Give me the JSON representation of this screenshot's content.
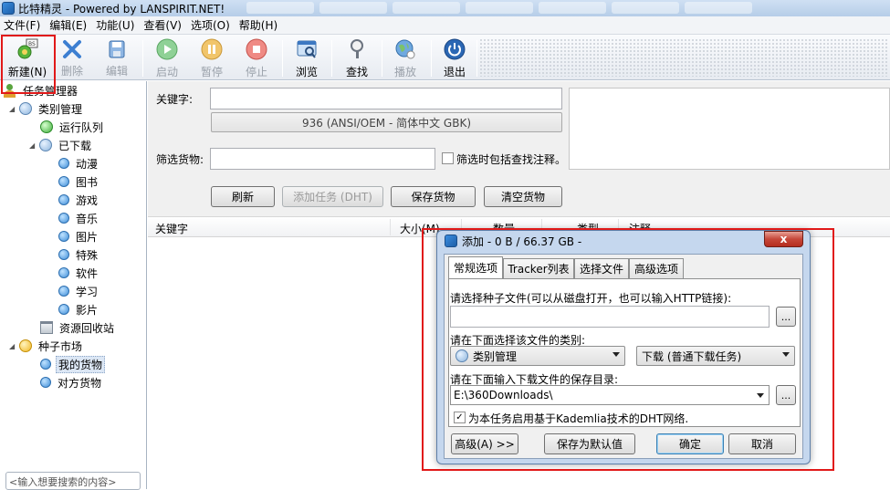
{
  "window": {
    "title": "比特精灵 - Powered by LANSPIRIT.NET!"
  },
  "menu": [
    "文件(F)",
    "编辑(E)",
    "功能(U)",
    "查看(V)",
    "选项(O)",
    "帮助(H)"
  ],
  "toolbar": {
    "new": "新建(N)",
    "delete": "删除",
    "edit": "编辑",
    "start": "启动",
    "pause": "暂停",
    "stop": "停止",
    "browse": "浏览",
    "find": "查找",
    "play": "播放",
    "exit": "退出"
  },
  "sidebar": {
    "root": "任务管理器",
    "category_mgmt": "类别管理",
    "running_queue": "运行队列",
    "downloaded": "已下载",
    "categories": [
      "动漫",
      "图书",
      "游戏",
      "音乐",
      "图片",
      "特殊",
      "软件",
      "学习",
      "影片"
    ],
    "recycle": "资源回收站",
    "seed_market": "种子市场",
    "my_goods": "我的货物",
    "other_goods": "对方货物",
    "search_placeholder": "<输入想要搜索的内容>"
  },
  "search_panel": {
    "keyword_label": "关键字:",
    "encoding": "936   (ANSI/OEM - 简体中文 GBK)",
    "filter_label": "筛选货物:",
    "filter_include_notes": "筛选时包括查找注释。",
    "refresh": "刷新",
    "add_task_dht": "添加任务 (DHT)",
    "save_goods": "保存货物",
    "clear_goods": "清空货物"
  },
  "list": {
    "headers": [
      "关键字",
      "大小(M)",
      "数量",
      "类型",
      "注释"
    ]
  },
  "dialog": {
    "title": "添加 - 0 B / 66.37 GB -",
    "close": "x",
    "tabs": [
      "常规选项",
      "Tracker列表",
      "选择文件",
      "高级选项"
    ],
    "seed_label": "请选择种子文件(可以从磁盘打开，也可以输入HTTP链接):",
    "seed_value": "",
    "ellipsis": "...",
    "category_label": "请在下面选择该文件的类别:",
    "category_value": "类别管理",
    "download_mode": "下载 (普通下载任务)",
    "dir_label": "请在下面输入下载文件的保存目录:",
    "dir_value": "E:\\360Downloads\\",
    "dht_checkbox": "为本任务启用基于Kademlia技术的DHT网络.",
    "dht_checked": true,
    "btn_advanced": "高级(A) >>",
    "btn_save_default": "保存为默认值",
    "btn_ok": "确定",
    "btn_cancel": "取消"
  }
}
